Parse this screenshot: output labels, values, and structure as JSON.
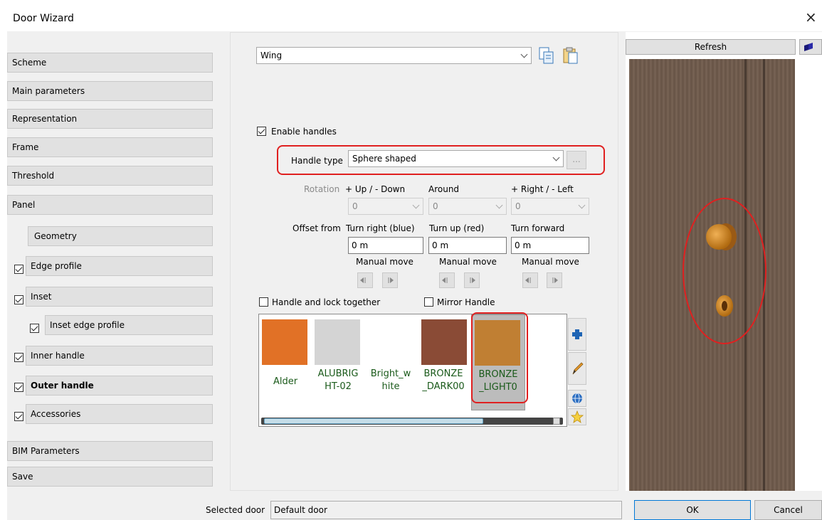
{
  "window": {
    "title": "Door Wizard",
    "close_glyph": "×"
  },
  "sidebar": {
    "items": [
      {
        "label": "Scheme"
      },
      {
        "label": "Main parameters"
      },
      {
        "label": "Representation"
      },
      {
        "label": "Frame"
      },
      {
        "label": "Threshold"
      },
      {
        "label": "Panel"
      },
      {
        "label": "Geometry"
      },
      {
        "label": "Edge profile",
        "checked": true
      },
      {
        "label": "Inset",
        "checked": true
      },
      {
        "label": "Inset edge profile",
        "checked": true
      },
      {
        "label": "Inner handle",
        "checked": true
      },
      {
        "label": "Outer handle",
        "checked": true,
        "selected": true
      },
      {
        "label": "Accessories",
        "checked": true
      },
      {
        "label": "BIM Parameters"
      },
      {
        "label": "Save"
      }
    ]
  },
  "main": {
    "part_select": {
      "value": "Wing"
    },
    "enable_handles": {
      "label": "Enable handles",
      "checked": true
    },
    "handle_type": {
      "label": "Handle type",
      "value": "Sphere shaped",
      "more": "..."
    },
    "rotation": {
      "label": "Rotation",
      "columns": [
        {
          "header": "+ Up / - Down",
          "value": "0"
        },
        {
          "header": "Around",
          "value": "0"
        },
        {
          "header": "+ Right / - Left",
          "value": "0"
        }
      ]
    },
    "offset": {
      "label": "Offset from",
      "columns": [
        {
          "header": "Turn right (blue)",
          "value": "0 m",
          "manual": "Manual move"
        },
        {
          "header": "Turn up (red)",
          "value": "0 m",
          "manual": "Manual move"
        },
        {
          "header": "Turn forward",
          "value": "0 m",
          "manual": "Manual move"
        }
      ]
    },
    "handle_lock_together": {
      "label": "Handle and lock together",
      "checked": false
    },
    "mirror_handle": {
      "label": "Mirror Handle",
      "checked": false
    },
    "materials": [
      {
        "name_l1": "",
        "name_l2": "Alder",
        "color": "#e17126"
      },
      {
        "name_l1": "ALUBRIG",
        "name_l2": "HT-02",
        "color": "#d4d4d4"
      },
      {
        "name_l1": "Bright_w",
        "name_l2": "hite",
        "color": "#ffffff"
      },
      {
        "name_l1": "BRONZE",
        "name_l2": "_DARK00",
        "color": "#8a4b36"
      },
      {
        "name_l1": "BRONZE",
        "name_l2": "_LIGHT0",
        "color": "#c07f33",
        "selected": true
      }
    ],
    "material_tools": [
      "plus-icon",
      "pencil-icon",
      "globe-icon",
      "star-icon"
    ]
  },
  "preview": {
    "refresh_label": "Refresh",
    "door_color": "#6e5a4c"
  },
  "footer": {
    "selected_door_label": "Selected door",
    "selected_door_value": "Default door",
    "ok_label": "OK",
    "cancel_label": "Cancel"
  },
  "colors": {
    "highlight": "#e02020",
    "accent": "#0078d7",
    "dialog_bg": "#f0f0f0"
  }
}
